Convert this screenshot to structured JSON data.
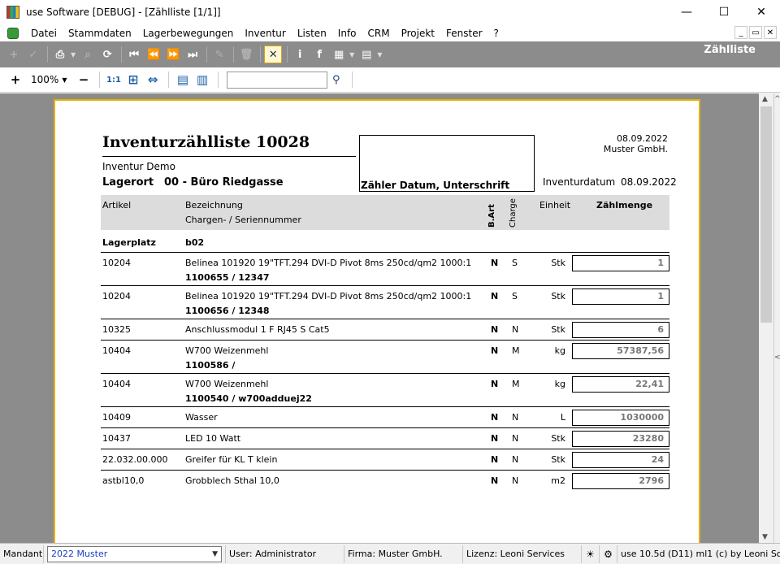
{
  "window": {
    "title": "use Software [DEBUG] - [Zählliste [1/1]]",
    "minimize": "—",
    "maximize": "☐",
    "close": "✕"
  },
  "menu": {
    "items": [
      "Datei",
      "Stammdaten",
      "Lagerbewegungen",
      "Inventur",
      "Listen",
      "Info",
      "CRM",
      "Projekt",
      "Fenster",
      "?"
    ],
    "mdi_minimize": "_",
    "mdi_restore": "▭",
    "mdi_close": "✕"
  },
  "toolbar": {
    "list_title": "Zählliste"
  },
  "preview_toolbar": {
    "zoom": "100%",
    "search_value": ""
  },
  "document": {
    "title": "Inventurzählliste 10028",
    "subtitle": "Inventur Demo",
    "lagerort_label": "Lagerort",
    "lagerort_value": "00 - Büro Riedgasse",
    "signature_label": "Zähler Datum, Unterschrift",
    "print_date": "08.09.2022",
    "company": "Muster GmbH.",
    "inventurdatum_label": "Inventurdatum",
    "inventurdatum_value": "08.09.2022",
    "headers": {
      "artikel": "Artikel",
      "bezeichnung": "Bezeichnung",
      "chargen": "Chargen- / Seriennummer",
      "bart": "B.Art",
      "charge": "Charge",
      "einheit": "Einheit",
      "zaehlmenge": "Zählmenge"
    },
    "lagerplatz_label": "Lagerplatz",
    "lagerplatz_value": "b02",
    "rows": [
      {
        "artikel": "10204",
        "bezeichnung": "Belinea 101920 19\"TFT.294 DVI-D Pivot 8ms 250cd/qm2 1000:1",
        "charge_nr": "1100655 / 12347",
        "bart": "N",
        "charge": "S",
        "einheit": "Stk",
        "menge": "1"
      },
      {
        "artikel": "10204",
        "bezeichnung": "Belinea 101920 19\"TFT.294 DVI-D Pivot 8ms 250cd/qm2 1000:1",
        "charge_nr": "1100656 / 12348",
        "bart": "N",
        "charge": "S",
        "einheit": "Stk",
        "menge": "1"
      },
      {
        "artikel": "10325",
        "bezeichnung": "Anschlussmodul 1 F RJ45 S Cat5",
        "charge_nr": "",
        "bart": "N",
        "charge": "N",
        "einheit": "Stk",
        "menge": "6"
      },
      {
        "artikel": "10404",
        "bezeichnung": "W700 Weizenmehl",
        "charge_nr": "1100586 /",
        "bart": "N",
        "charge": "M",
        "einheit": "kg",
        "menge": "57387,56"
      },
      {
        "artikel": "10404",
        "bezeichnung": "W700 Weizenmehl",
        "charge_nr": "1100540 / w700adduej22",
        "bart": "N",
        "charge": "M",
        "einheit": "kg",
        "menge": "22,41"
      },
      {
        "artikel": "10409",
        "bezeichnung": "Wasser",
        "charge_nr": "",
        "bart": "N",
        "charge": "N",
        "einheit": "L",
        "menge": "1030000"
      },
      {
        "artikel": "10437",
        "bezeichnung": "LED 10 Watt",
        "charge_nr": "",
        "bart": "N",
        "charge": "N",
        "einheit": "Stk",
        "menge": "23280"
      },
      {
        "artikel": "22.032.00.000",
        "bezeichnung": "Greifer für KL T klein",
        "charge_nr": "",
        "bart": "N",
        "charge": "N",
        "einheit": "Stk",
        "menge": "24"
      },
      {
        "artikel": "astbl10,0",
        "bezeichnung": "Grobblech Sthal 10,0",
        "charge_nr": "",
        "bart": "N",
        "charge": "N",
        "einheit": "m2",
        "menge": "2796"
      }
    ]
  },
  "statusbar": {
    "mandant_label": "Mandant",
    "mandant_value": "2022 Muster",
    "user": "User: Administrator",
    "firma": "Firma: Muster GmbH.",
    "lizenz": "Lizenz: Leoni Services",
    "version": "use 10.5d (D11) ml1 (c) by Leoni So"
  }
}
